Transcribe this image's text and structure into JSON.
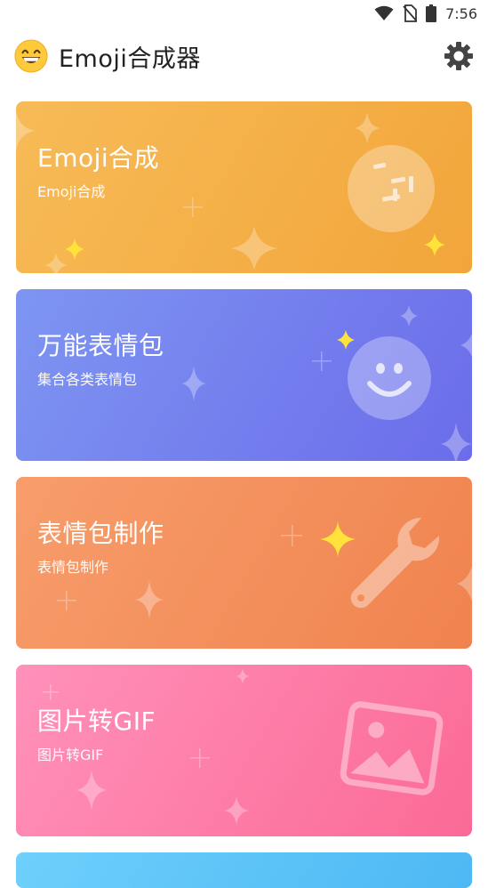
{
  "status_bar": {
    "time": "7:56",
    "icons": [
      "wifi-icon",
      "no-sim-icon",
      "battery-icon"
    ]
  },
  "app_bar": {
    "title": "Emoji合成器",
    "logo_icon": "grinning-face-icon",
    "settings_icon": "gear-icon"
  },
  "cards": [
    {
      "title": "Emoji合成",
      "subtitle": "Emoji合成",
      "icon": "emoji-face-icon",
      "color": "#f5b04a"
    },
    {
      "title": "万能表情包",
      "subtitle": "集合各类表情包",
      "icon": "smiley-face-icon",
      "color": "#737eee"
    },
    {
      "title": "表情包制作",
      "subtitle": "表情包制作",
      "icon": "wrench-icon",
      "color": "#f48f5c"
    },
    {
      "title": "图片转GIF",
      "subtitle": "图片转GIF",
      "icon": "image-icon",
      "color": "#fc7ca6"
    },
    {
      "title": "",
      "subtitle": "",
      "icon": "",
      "color": "#5ec3f7"
    }
  ]
}
